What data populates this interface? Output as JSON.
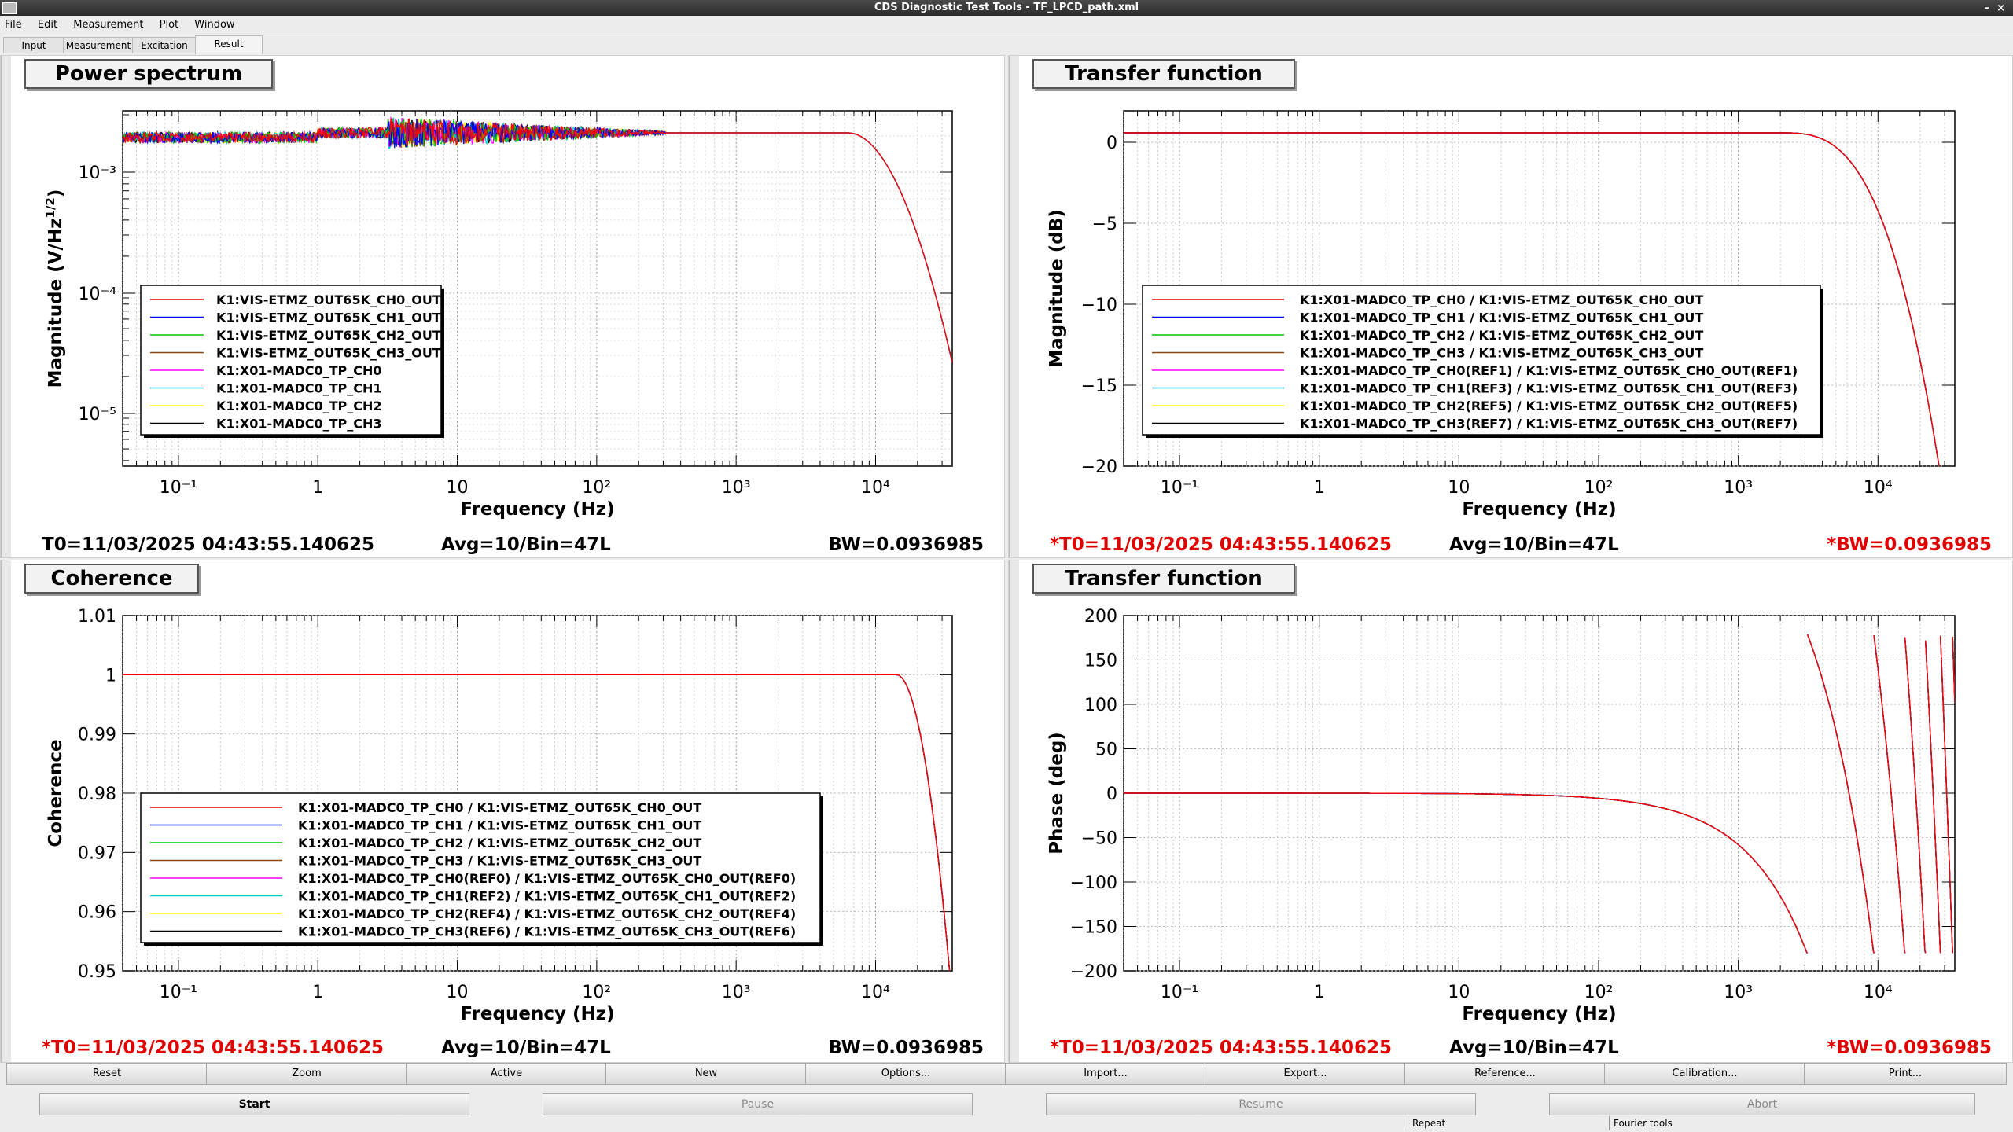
{
  "window": {
    "title": "CDS Diagnostic Test Tools - TF_LPCD_path.xml"
  },
  "menu": [
    "File",
    "Edit",
    "Measurement",
    "Plot",
    "Window"
  ],
  "tabs": [
    "Input",
    "Measurement",
    "Excitation",
    "Result"
  ],
  "active_tab": "Result",
  "panels": [
    {
      "title": "Power spectrum",
      "xlabel": "Frequency (Hz)",
      "ylabel": "Magnitude (V/Hz^1/2)",
      "ylabel_main": "Magnitude (V/Hz",
      "ylabel_sup": "1/2",
      "ylabel_end": ")",
      "xticks": [
        "10⁻¹",
        "1",
        "10",
        "10²",
        "10³",
        "10⁴"
      ],
      "yticks": [
        "10⁻³",
        "10⁻⁴",
        "10⁻⁵"
      ],
      "legend": [
        "K1:VIS-ETMZ_OUT65K_CH0_OUT",
        "K1:VIS-ETMZ_OUT65K_CH1_OUT",
        "K1:VIS-ETMZ_OUT65K_CH2_OUT",
        "K1:VIS-ETMZ_OUT65K_CH3_OUT",
        "K1:X01-MADC0_TP_CH0",
        "K1:X01-MADC0_TP_CH1",
        "K1:X01-MADC0_TP_CH2",
        "K1:X01-MADC0_TP_CH3"
      ],
      "footer": {
        "t0": "T0=11/03/2025 04:43:55.140625",
        "avg": "Avg=10/Bin=47L",
        "bw": "BW=0.0936985",
        "red": false
      }
    },
    {
      "title": "Transfer function",
      "xlabel": "Frequency (Hz)",
      "ylabel": "Magnitude (dB)",
      "xticks": [
        "10⁻¹",
        "1",
        "10",
        "10²",
        "10³",
        "10⁴"
      ],
      "yticks": [
        "0",
        "−5",
        "−10",
        "−15",
        "−20"
      ],
      "legend": [
        "K1:X01-MADC0_TP_CH0 / K1:VIS-ETMZ_OUT65K_CH0_OUT",
        "K1:X01-MADC0_TP_CH1 / K1:VIS-ETMZ_OUT65K_CH1_OUT",
        "K1:X01-MADC0_TP_CH2 / K1:VIS-ETMZ_OUT65K_CH2_OUT",
        "K1:X01-MADC0_TP_CH3 / K1:VIS-ETMZ_OUT65K_CH3_OUT",
        "K1:X01-MADC0_TP_CH0(REF1) / K1:VIS-ETMZ_OUT65K_CH0_OUT(REF1)",
        "K1:X01-MADC0_TP_CH1(REF3) / K1:VIS-ETMZ_OUT65K_CH1_OUT(REF3)",
        "K1:X01-MADC0_TP_CH2(REF5) / K1:VIS-ETMZ_OUT65K_CH2_OUT(REF5)",
        "K1:X01-MADC0_TP_CH3(REF7) / K1:VIS-ETMZ_OUT65K_CH3_OUT(REF7)"
      ],
      "footer": {
        "t0": "*T0=11/03/2025 04:43:55.140625",
        "avg": "Avg=10/Bin=47L",
        "bw": "*BW=0.0936985",
        "red": true
      }
    },
    {
      "title": "Coherence",
      "xlabel": "Frequency (Hz)",
      "ylabel": "Coherence",
      "xticks": [
        "10⁻¹",
        "1",
        "10",
        "10²",
        "10³",
        "10⁴"
      ],
      "yticks": [
        "1.01",
        "1",
        "0.99",
        "0.98",
        "0.97",
        "0.96",
        "0.95"
      ],
      "legend": [
        "K1:X01-MADC0_TP_CH0 / K1:VIS-ETMZ_OUT65K_CH0_OUT",
        "K1:X01-MADC0_TP_CH1 / K1:VIS-ETMZ_OUT65K_CH1_OUT",
        "K1:X01-MADC0_TP_CH2 / K1:VIS-ETMZ_OUT65K_CH2_OUT",
        "K1:X01-MADC0_TP_CH3 / K1:VIS-ETMZ_OUT65K_CH3_OUT",
        "K1:X01-MADC0_TP_CH0(REF0) / K1:VIS-ETMZ_OUT65K_CH0_OUT(REF0)",
        "K1:X01-MADC0_TP_CH1(REF2) / K1:VIS-ETMZ_OUT65K_CH1_OUT(REF2)",
        "K1:X01-MADC0_TP_CH2(REF4) / K1:VIS-ETMZ_OUT65K_CH2_OUT(REF4)",
        "K1:X01-MADC0_TP_CH3(REF6) / K1:VIS-ETMZ_OUT65K_CH3_OUT(REF6)"
      ],
      "footer": {
        "t0": "*T0=11/03/2025 04:43:55.140625",
        "avg": "Avg=10/Bin=47L",
        "bw": "BW=0.0936985",
        "red": "t0"
      }
    },
    {
      "title": "Transfer function",
      "xlabel": "Frequency (Hz)",
      "ylabel": "Phase (deg)",
      "xticks": [
        "10⁻¹",
        "1",
        "10",
        "10²",
        "10³",
        "10⁴"
      ],
      "yticks": [
        "200",
        "150",
        "100",
        "50",
        "0",
        "−50",
        "−100",
        "−150",
        "−200"
      ],
      "legend": [],
      "footer": {
        "t0": "*T0=11/03/2025 04:43:55.140625",
        "avg": "Avg=10/Bin=47L",
        "bw": "*BW=0.0936985",
        "red": true
      }
    }
  ],
  "series_colors": [
    "#ff0000",
    "#0000ff",
    "#00cc00",
    "#8b4513",
    "#ff00ff",
    "#00cccc",
    "#ffff00",
    "#000000"
  ],
  "buttons_row1": [
    "Reset",
    "Zoom",
    "Active",
    "New",
    "Options...",
    "Import...",
    "Export...",
    "Reference...",
    "Calibration...",
    "Print..."
  ],
  "buttons_row2": [
    "Start",
    "Pause",
    "Resume",
    "Abort"
  ],
  "status": [
    "Repeat",
    "Fourier tools"
  ]
}
